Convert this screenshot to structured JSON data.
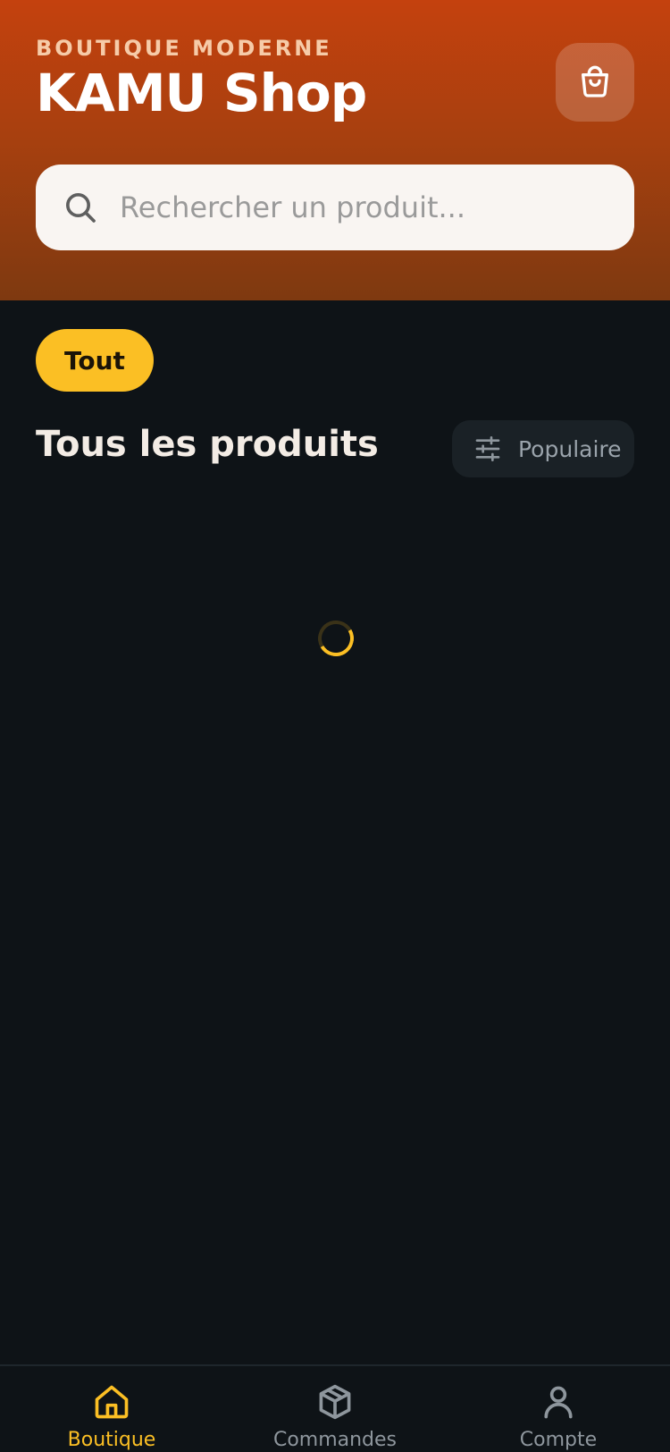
{
  "header": {
    "eyebrow": "BOUTIQUE MODERNE",
    "title": "KAMU Shop",
    "cart_icon": "shopping-bag-icon"
  },
  "search": {
    "placeholder": "Rechercher un produit...",
    "value": "",
    "icon": "search-icon"
  },
  "categories": [
    {
      "label": "Tout",
      "selected": true
    }
  ],
  "section": {
    "title": "Tous les produits",
    "sort_label": "Populaire",
    "sort_icon": "filter-sliders-icon"
  },
  "loading": true,
  "bottom_nav": {
    "items": [
      {
        "label": "Boutique",
        "icon": "home-icon",
        "active": true
      },
      {
        "label": "Commandes",
        "icon": "package-icon",
        "active": false
      },
      {
        "label": "Compte",
        "icon": "user-icon",
        "active": false
      }
    ]
  },
  "colors": {
    "accent": "#fbbf24",
    "header_start": "#c4410e",
    "header_end": "#7e3910",
    "background": "#0e1317",
    "inactive": "#8e969d"
  }
}
